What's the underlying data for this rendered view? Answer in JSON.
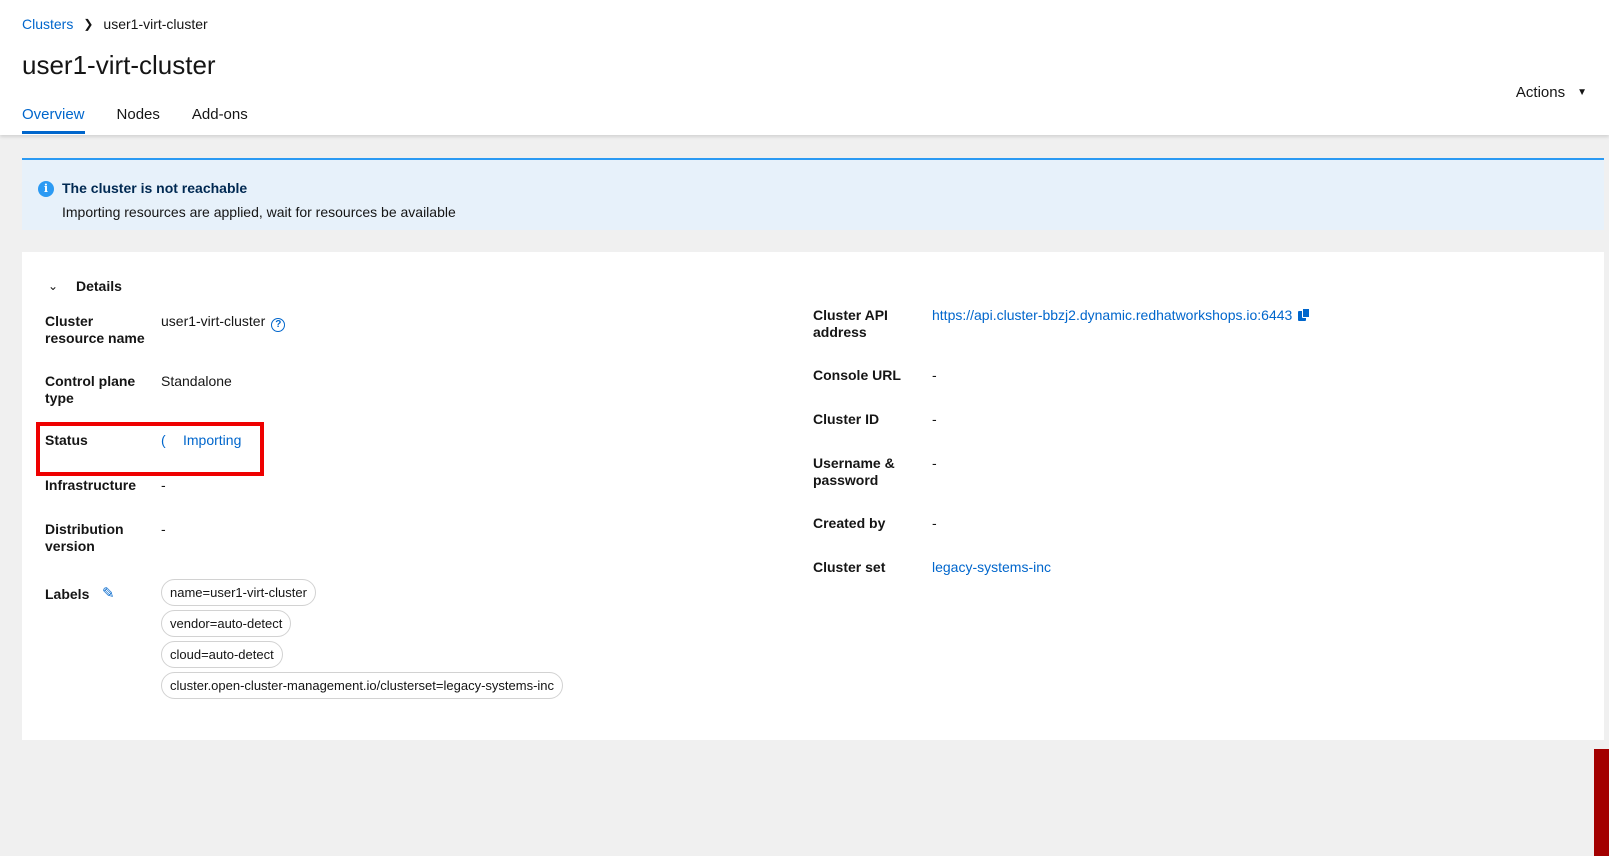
{
  "breadcrumb": {
    "root": "Clusters",
    "current": "user1-virt-cluster"
  },
  "page_title": "user1-virt-cluster",
  "tabs": [
    {
      "label": "Overview"
    },
    {
      "label": "Nodes"
    },
    {
      "label": "Add-ons"
    }
  ],
  "actions_label": "Actions",
  "alert": {
    "title": "The cluster is not reachable",
    "description": "Importing resources are applied, wait for resources be available"
  },
  "details": {
    "section_label": "Details",
    "left": {
      "cluster_resource_name": {
        "term": "Cluster resource name",
        "value": "user1-virt-cluster"
      },
      "control_plane_type": {
        "term": "Control plane type",
        "value": "Standalone"
      },
      "status": {
        "term": "Status",
        "spinner": "(",
        "value": "Importing"
      },
      "infrastructure": {
        "term": "Infrastructure",
        "value": "-"
      },
      "distribution_version": {
        "term": "Distribution version",
        "value": "-"
      },
      "labels": {
        "term": "Labels",
        "chips": [
          "name=user1-virt-cluster",
          "vendor=auto-detect",
          "cloud=auto-detect",
          "cluster.open-cluster-management.io/clusterset=legacy-systems-inc"
        ]
      }
    },
    "right": {
      "cluster_api_address": {
        "term": "Cluster API address",
        "value": "https://api.cluster-bbzj2.dynamic.redhatworkshops.io:6443"
      },
      "console_url": {
        "term": "Console URL",
        "value": "-"
      },
      "cluster_id": {
        "term": "Cluster ID",
        "value": "-"
      },
      "username_password": {
        "term": "Username & password",
        "value": "-"
      },
      "created_by": {
        "term": "Created by",
        "value": "-"
      },
      "cluster_set": {
        "term": "Cluster set",
        "value": "legacy-systems-inc"
      }
    }
  },
  "colors": {
    "link": "#0066cc",
    "alert_bg": "#e7f1fa",
    "alert_border": "#2b9af3",
    "highlight": "#ee0000"
  }
}
